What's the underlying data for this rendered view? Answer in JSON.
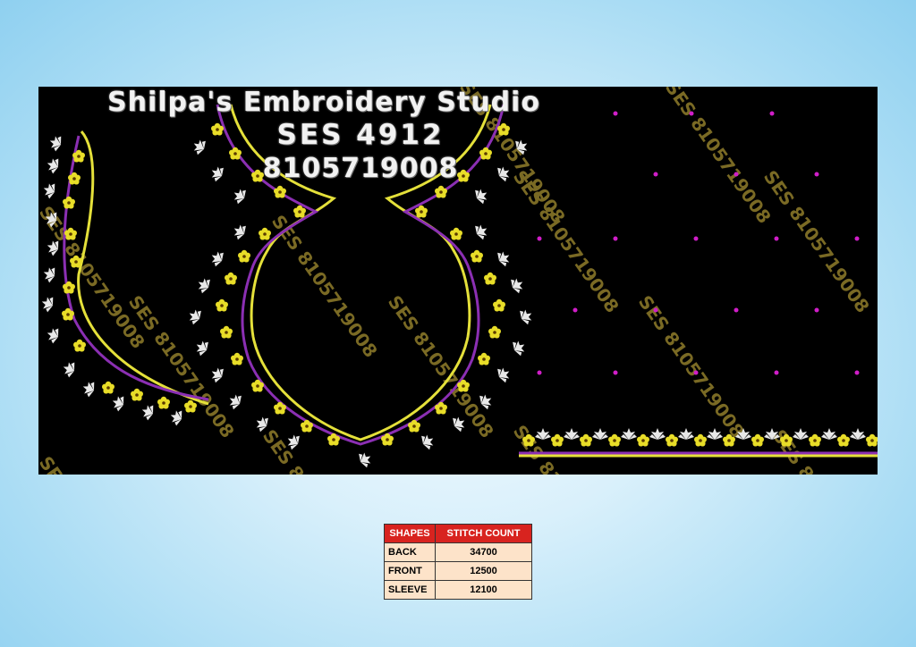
{
  "studio": {
    "name": "Shilpa's Embroidery Studio",
    "design_code": "SES 4912",
    "phone": "8105719008"
  },
  "watermark_text": "SES 8105719008",
  "colors": {
    "outline": "#e4e03a",
    "purple": "#8b2fb3",
    "flower": "#e8dd28",
    "leaf": "#e8e8e8",
    "dot": "#d01ec8"
  },
  "table": {
    "header_shapes": "SHAPES",
    "header_stitch": "STITCH COUNT",
    "rows": [
      {
        "shape": "BACK",
        "count": "34700"
      },
      {
        "shape": "FRONT",
        "count": "12500"
      },
      {
        "shape": "SLEEVE",
        "count": "12100"
      }
    ]
  }
}
